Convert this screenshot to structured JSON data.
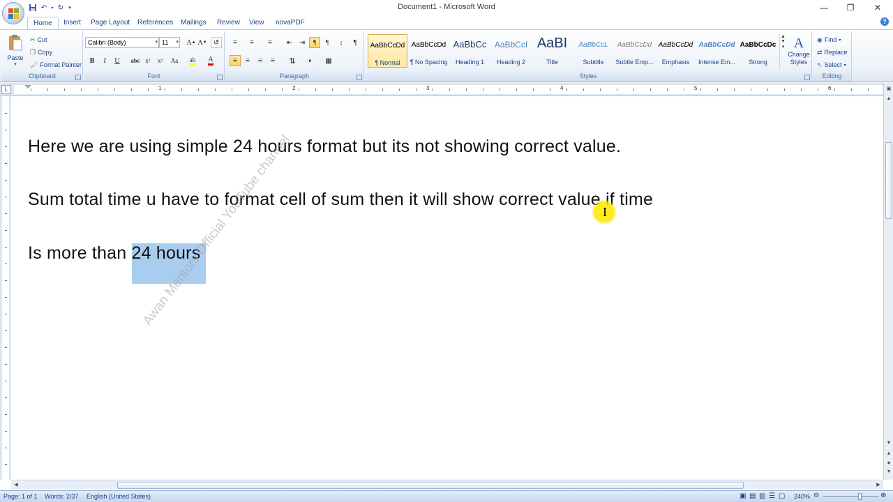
{
  "window": {
    "title": "Document1 - Microsoft Word"
  },
  "quick_access": [
    "save-icon",
    "undo-icon",
    "redo-icon",
    "customize-icon"
  ],
  "tabs": [
    {
      "label": "Home",
      "active": true
    },
    {
      "label": "Insert"
    },
    {
      "label": "Page Layout"
    },
    {
      "label": "References"
    },
    {
      "label": "Mailings"
    },
    {
      "label": "Review"
    },
    {
      "label": "View"
    },
    {
      "label": "novaPDF"
    }
  ],
  "ribbon": {
    "clipboard": {
      "paste": "Paste",
      "cut": "Cut",
      "copy": "Copy",
      "format_painter": "Format Painter",
      "label": "Clipboard"
    },
    "font": {
      "family": "Calibri (Body)",
      "size": "11",
      "label": "Font",
      "bold": "B",
      "italic": "I",
      "underline": "U"
    },
    "paragraph": {
      "label": "Paragraph"
    },
    "styles": {
      "label": "Styles",
      "items": [
        {
          "sample": "AaBbCcDd",
          "name": "¶ Normal"
        },
        {
          "sample": "AaBbCcDd",
          "name": "¶ No Spacing"
        },
        {
          "sample": "AaBbCc",
          "name": "Heading 1"
        },
        {
          "sample": "AaBbCcI",
          "name": "Heading 2"
        },
        {
          "sample": "AaBI",
          "name": "Title"
        },
        {
          "sample": "AaBbCcL",
          "name": "Subtitle"
        },
        {
          "sample": "AaBbCcDd",
          "name": "Subtle Emp..."
        },
        {
          "sample": "AaBbCcDd",
          "name": "Emphasis"
        },
        {
          "sample": "AaBbCcDd",
          "name": "Intense Em..."
        },
        {
          "sample": "AaBbCcDc",
          "name": "Strong"
        }
      ],
      "change_styles": "Change Styles"
    },
    "editing": {
      "label": "Editing",
      "find": "Find",
      "replace": "Replace",
      "select": "Select"
    }
  },
  "ruler": {
    "numbers": [
      "1",
      "2",
      "3",
      "4",
      "5",
      "6"
    ],
    "tab_selector": "L"
  },
  "document": {
    "line1": "Here we are using simple 24 hours format but its not showing correct value.",
    "line2": "Sum total time u have to format cell of sum then it will show correct value if time",
    "line3_prefix": "Is more than ",
    "line3_selected": "24 hours",
    "watermark": "Awan Mentors Official YouTube channel"
  },
  "status": {
    "page": "Page: 1 of 1",
    "words": "Words: 2/37",
    "language": "English (United States)",
    "zoom": "240%"
  },
  "colors": {
    "selection": "#a9cdef",
    "cursor_highlight": "#ffe600",
    "ribbon_text": "#15428b"
  }
}
